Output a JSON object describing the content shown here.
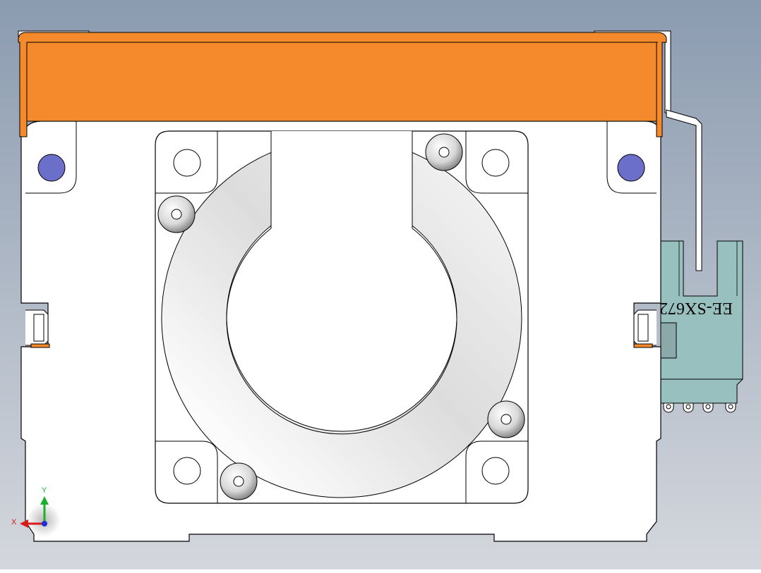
{
  "viewport": {
    "background_top": "#8b9bb0",
    "background_bottom": "#d4d7dd"
  },
  "drawing": {
    "part_fill": "#ffffff",
    "outline": "#000000",
    "cover_color": "#f58a2c",
    "sensor_color": "#98c0be",
    "dowel_color": "#6b6fc9",
    "sensor_label": "EE-SX672"
  },
  "triad": {
    "x_label": "X",
    "y_label": "Y",
    "x_color": "#d81b1b",
    "y_color": "#1fae2b",
    "z_color": "#1b2fd8"
  }
}
